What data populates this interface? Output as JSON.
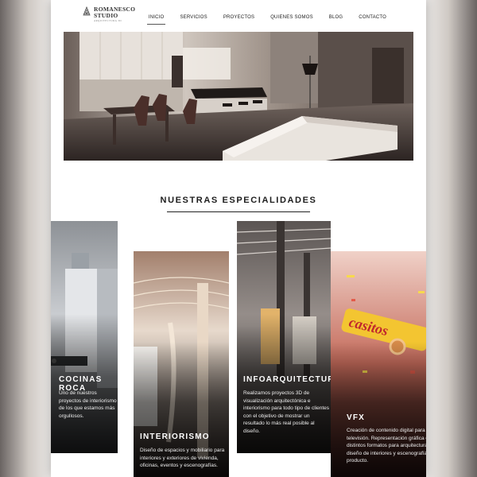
{
  "brand": {
    "line1": "ROMANESCO",
    "line2": "STUDIO",
    "tagline": "ARQUITECTURA 3D"
  },
  "nav": {
    "items": [
      {
        "label": "INICIO",
        "active": true
      },
      {
        "label": "SERVICIOS",
        "active": false
      },
      {
        "label": "PROYECTOS",
        "active": false
      },
      {
        "label": "QUIENES SOMOS",
        "active": false
      },
      {
        "label": "BLOG",
        "active": false
      },
      {
        "label": "CONTACTO",
        "active": false
      }
    ]
  },
  "section": {
    "title": "NUESTRAS ESPECIALIDADES"
  },
  "cards": [
    {
      "title": "COCINAS ROCA",
      "text": "Uno de nuestros proyectos de interiorismo de los que estamos más orgullosos."
    },
    {
      "title": "INTERIORISMO",
      "text": "Diseño de espacios y mobiliario para interiores y exteriores de vivienda, oficinas, eventos y escenografías."
    },
    {
      "title": "INFOARQUITECTURA",
      "text": "Realizamos proyectos 3D de visualización arquitectónica e interiorismo para todo tipo de clientes con el objetivo de mostrar un resultado lo más real posible al diseño."
    },
    {
      "title": "VFX",
      "text": "Creación de contenido digital para cine y televisión. Representación gráfica en distintos formatos para arquitectura, diseño de interiores y escenografía y producto."
    }
  ],
  "colors": {
    "title_rule": "#222222",
    "card_text": "#ffffff"
  }
}
